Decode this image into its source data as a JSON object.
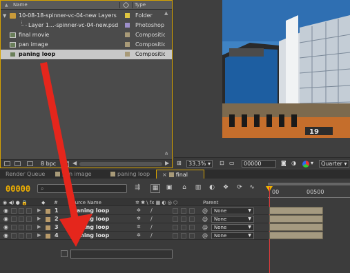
{
  "colors": {
    "selection_border": "#d7a300",
    "timecode": "#f0b000",
    "arrow": "#e5261c",
    "playhead": "#d93a3a",
    "layer_bar": "#a59a80"
  },
  "project": {
    "columns": {
      "name": "Name",
      "type": "Type"
    },
    "items": [
      {
        "name": "10-08-18-spinner-vc-04-new Layers",
        "type": "Folder",
        "icon": "folder-icon",
        "label_color": "#e0c640"
      },
      {
        "name": "Layer 1...-spinner-vc-04-new.psd",
        "type": "Photoshop",
        "icon": "photoshop-file-icon",
        "label_color": "#9d8fc9"
      },
      {
        "name": "final movie",
        "type": "Compositio",
        "icon": "composition-icon",
        "label_color": "#a89a78"
      },
      {
        "name": "pan image",
        "type": "Compositio",
        "icon": "composition-icon",
        "label_color": "#a89a78"
      },
      {
        "name": "paning loop",
        "type": "Compositio",
        "icon": "composition-icon",
        "label_color": "#a89a78"
      }
    ],
    "footer": {
      "bpc": "8 bpc"
    }
  },
  "viewer": {
    "zoom": "33.3%",
    "timecode": "00000",
    "resolution": "Quarter"
  },
  "tabs": [
    {
      "label": "Render Queue",
      "swatch": ""
    },
    {
      "label": "pan image",
      "swatch": "#a89a78"
    },
    {
      "label": "paning loop",
      "swatch": "#a89a78"
    },
    {
      "label": "final movie",
      "swatch": "#a89a78"
    }
  ],
  "timeline": {
    "timecode": "00000",
    "search_placeholder": "",
    "column_source_name": "Source Name",
    "column_parent": "Parent",
    "ruler": {
      "start": "00",
      "mark": "00500"
    },
    "layers": [
      {
        "number": "1",
        "source": "paning loop",
        "parent": "None"
      },
      {
        "number": "2",
        "source": "paning loop",
        "parent": "None"
      },
      {
        "number": "3",
        "source": "paning loop",
        "parent": "None"
      },
      {
        "number": "4",
        "source": "paning loop",
        "parent": "None"
      }
    ]
  }
}
